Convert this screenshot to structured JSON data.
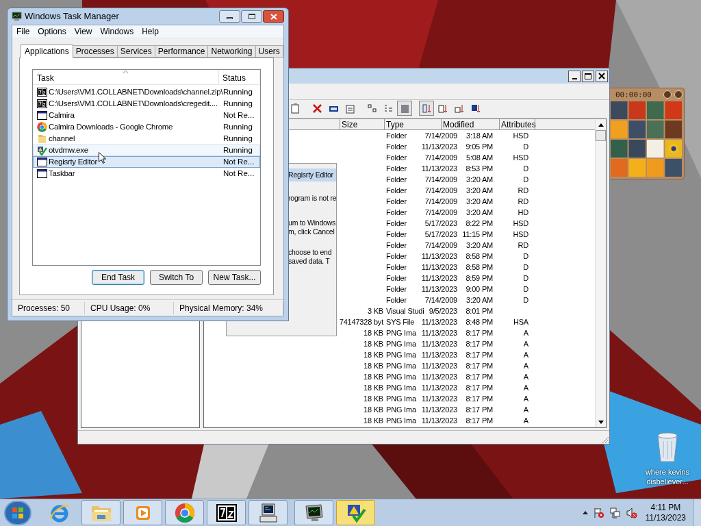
{
  "desktop": {
    "icons": [
      {
        "label": "where kevins disbeliever..."
      }
    ]
  },
  "puzzle_gadget": {
    "timer": "00:00:00"
  },
  "file_manager": {
    "columns": [
      "Size",
      "Type",
      "Modified",
      "Attributes"
    ],
    "rows": [
      {
        "size": "",
        "type": "Folder",
        "date": "7/14/2009",
        "time": "3:18 AM",
        "attributes": "HSD"
      },
      {
        "size": "",
        "type": "Folder",
        "date": "11/13/2023",
        "time": "9:05 PM",
        "attributes": "D"
      },
      {
        "size": "",
        "type": "Folder",
        "date": "7/14/2009",
        "time": "5:08 AM",
        "attributes": "HSD"
      },
      {
        "size": "",
        "type": "Folder",
        "date": "11/13/2023",
        "time": "8:53 PM",
        "attributes": "D"
      },
      {
        "size": "",
        "type": "Folder",
        "date": "7/14/2009",
        "time": "3:20 AM",
        "attributes": "D"
      },
      {
        "size": "",
        "type": "Folder",
        "date": "7/14/2009",
        "time": "3:20 AM",
        "attributes": "RD"
      },
      {
        "size": "",
        "type": "Folder",
        "date": "7/14/2009",
        "time": "3:20 AM",
        "attributes": "RD"
      },
      {
        "size": "",
        "type": "Folder",
        "date": "7/14/2009",
        "time": "3:20 AM",
        "attributes": "HD"
      },
      {
        "size": "",
        "type": "Folder",
        "date": "5/17/2023",
        "time": "8:22 PM",
        "attributes": "HSD"
      },
      {
        "size": "",
        "type": "Folder",
        "date": "5/17/2023",
        "time": "11:15 PM",
        "attributes": "HSD"
      },
      {
        "size": "",
        "type": "Folder",
        "date": "7/14/2009",
        "time": "3:20 AM",
        "attributes": "RD"
      },
      {
        "size": "",
        "type": "Folder",
        "date": "11/13/2023",
        "time": "8:58 PM",
        "attributes": "D"
      },
      {
        "size": "",
        "type": "Folder",
        "date": "11/13/2023",
        "time": "8:58 PM",
        "attributes": "D"
      },
      {
        "size": "",
        "type": "Folder",
        "date": "11/13/2023",
        "time": "8:59 PM",
        "attributes": "D"
      },
      {
        "size": "",
        "type": "Folder",
        "date": "11/13/2023",
        "time": "9:00 PM",
        "attributes": "D"
      },
      {
        "size": "",
        "type": "Folder",
        "date": "7/14/2009",
        "time": "3:20 AM",
        "attributes": "D"
      },
      {
        "size": "3 KB",
        "type": "Visual Studi",
        "date": "9/5/2023",
        "time": "8:01 PM",
        "attributes": ""
      },
      {
        "size": "74147328 byt",
        "type": "SYS File",
        "date": "11/13/2023",
        "time": "8:48 PM",
        "attributes": "HSA"
      },
      {
        "size": "18 KB",
        "type": "PNG Ima",
        "date": "11/13/2023",
        "time": "8:17 PM",
        "attributes": "A"
      },
      {
        "size": "18 KB",
        "type": "PNG Ima",
        "date": "11/13/2023",
        "time": "8:17 PM",
        "attributes": "A"
      },
      {
        "size": "18 KB",
        "type": "PNG Ima",
        "date": "11/13/2023",
        "time": "8:17 PM",
        "attributes": "A"
      },
      {
        "size": "18 KB",
        "type": "PNG Ima",
        "date": "11/13/2023",
        "time": "8:17 PM",
        "attributes": "A"
      },
      {
        "size": "18 KB",
        "type": "PNG Ima",
        "date": "11/13/2023",
        "time": "8:17 PM",
        "attributes": "A"
      },
      {
        "size": "18 KB",
        "type": "PNG Ima",
        "date": "11/13/2023",
        "time": "8:17 PM",
        "attributes": "A"
      },
      {
        "size": "18 KB",
        "type": "PNG Ima",
        "date": "11/13/2023",
        "time": "8:17 PM",
        "attributes": "A"
      },
      {
        "size": "18 KB",
        "type": "PNG Ima",
        "date": "11/13/2023",
        "time": "8:17 PM",
        "attributes": "A"
      },
      {
        "size": "18 KB",
        "type": "PNG Ima",
        "date": "11/13/2023",
        "time": "8:17 PM",
        "attributes": "A"
      }
    ]
  },
  "dialog": {
    "title": "Regisrty Editor",
    "lines": [
      "rogram is not re",
      "um to Windows",
      "m, click Cancel",
      "choose to end",
      "saved data. T"
    ]
  },
  "task_manager": {
    "title": "Windows Task Manager",
    "menu": [
      "File",
      "Options",
      "View",
      "Windows",
      "Help"
    ],
    "tabs": [
      {
        "label": "Applications",
        "selected": true
      },
      {
        "label": "Processes",
        "selected": false
      },
      {
        "label": "Services",
        "selected": false
      },
      {
        "label": "Performance",
        "selected": false
      },
      {
        "label": "Networking",
        "selected": false
      },
      {
        "label": "Users",
        "selected": false
      }
    ],
    "columns": [
      "Task",
      "Status"
    ],
    "rows": [
      {
        "kind": "archive",
        "task": "C:\\Users\\VM1.COLLABNET\\Downloads\\channel.zip\\",
        "status": "Running",
        "selected": false,
        "hovered": false
      },
      {
        "kind": "archive",
        "task": "C:\\Users\\VM1.COLLABNET\\Downloads\\cregedit....",
        "status": "Running",
        "selected": false,
        "hovered": false
      },
      {
        "kind": "window",
        "task": "Calmira",
        "status": "Not Re...",
        "selected": false,
        "hovered": false
      },
      {
        "kind": "browser",
        "task": "Calmira Downloads - Google Chrome",
        "status": "Running",
        "selected": false,
        "hovered": false
      },
      {
        "kind": "folder",
        "task": "channel",
        "status": "Running",
        "selected": false,
        "hovered": false
      },
      {
        "kind": "app",
        "task": "otvdmw.exe",
        "status": "Running",
        "selected": false,
        "hovered": true
      },
      {
        "kind": "window",
        "task": "Regisrty Editor",
        "status": "Not Re...",
        "selected": true,
        "hovered": false
      },
      {
        "kind": "window",
        "task": "Taskbar",
        "status": "Not Re...",
        "selected": false,
        "hovered": false
      }
    ],
    "buttons": [
      {
        "label": "End Task",
        "default": true
      },
      {
        "label": "Switch To",
        "default": false
      },
      {
        "label": "New Task...",
        "default": false
      }
    ],
    "status_bar": [
      "Processes: 50",
      "CPU Usage: 0%",
      "Physical Memory: 34%"
    ]
  },
  "taskbar": {
    "buttons": [
      {
        "kind": "browser-e",
        "running": false,
        "flashing": false
      },
      {
        "kind": "folder",
        "running": true,
        "flashing": false
      },
      {
        "kind": "media",
        "running": true,
        "flashing": false
      },
      {
        "kind": "chrome",
        "running": true,
        "flashing": false
      },
      {
        "kind": "archive",
        "running": true,
        "flashing": false
      },
      {
        "kind": "computer",
        "running": true,
        "flashing": false
      },
      {
        "kind": "monitor",
        "running": true,
        "flashing": false
      },
      {
        "kind": "warning",
        "running": true,
        "flashing": true
      }
    ],
    "tray": [
      {
        "kind": "arrow"
      },
      {
        "kind": "flag"
      },
      {
        "kind": "network"
      },
      {
        "kind": "volume"
      }
    ],
    "clock": {
      "time": "4:11 PM",
      "date": "11/13/2023"
    }
  }
}
